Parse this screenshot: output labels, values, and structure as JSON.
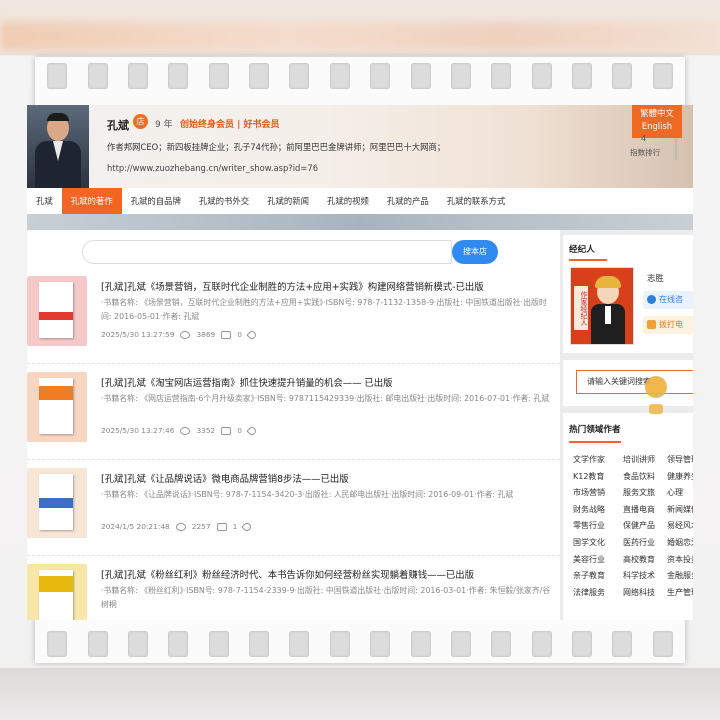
{
  "author": {
    "name": "孔斌",
    "badge": "店",
    "years": "9 年",
    "membership": "创始终身会员 | 好书会员",
    "bio": "作者邦网CEO；新四板挂牌企业；孔子74代孙；前阿里巴巴金牌讲师；阿里巴巴十大网商；",
    "url": "http://www.zuozhebang.cn/writer_show.asp?id=76"
  },
  "lang": {
    "trad": "繁體中文",
    "en": "English"
  },
  "rank": {
    "number": "4",
    "label": "指数排行"
  },
  "nav": [
    {
      "label": "孔斌",
      "active": false
    },
    {
      "label": "孔斌的著作",
      "active": true
    },
    {
      "label": "孔斌的自品牌",
      "active": false
    },
    {
      "label": "孔斌的书外交",
      "active": false
    },
    {
      "label": "孔斌的新闻",
      "active": false
    },
    {
      "label": "孔斌的视频",
      "active": false
    },
    {
      "label": "孔斌的产品",
      "active": false
    },
    {
      "label": "孔斌的联系方式",
      "active": false
    }
  ],
  "search": {
    "placeholder": "",
    "button": "搜本店"
  },
  "books": [
    {
      "title": "[孔斌]孔斌《场景营销，互联时代企业制胜的方法+应用+实践》构建网络营销新模式-已出版",
      "meta": "·书籍名称: 《场景营销，互联时代企业制胜的方法+应用+实践》·ISBN号: 978-7-1132-1358-9·出版社: 中国铁道出版社·出版时间: 2016-05-01·作者: 孔斌",
      "date": "2025/5/30 13:27:59",
      "views": "3869",
      "comments": "0",
      "cover_bg": "#f6c9c9",
      "cover_stripe": "#e23a2c"
    },
    {
      "title": "[孔斌]孔斌《淘宝网店运营指南》抓住快速提升销量的机会—— 已出版",
      "meta": "·书籍名称: 《网店运营指南-6个月升级卖家》·ISBN号: 9787115429339·出版社: 邮电出版社·出版时间: 2016-07-01·作者: 孔斌",
      "date": "2025/5/30 13:27:46",
      "views": "3352",
      "comments": "0",
      "cover_bg": "#f8d6c2",
      "cover_stripe": "#ef7d22"
    },
    {
      "title": "[孔斌]孔斌《让品牌说话》微电商品牌营销8步法——已出版",
      "meta": "·书籍名称: 《让品牌说话》·ISBN号: 978-7-1154-3420-3·出版社: 人民邮电出版社·出版时间: 2016-09-01·作者: 孔斌",
      "date": "2024/1/5 20:21:48",
      "views": "2257",
      "comments": "1",
      "cover_bg": "#f7e6d5",
      "cover_stripe": "#3a6fc4"
    },
    {
      "title": "[孔斌]孔斌《粉丝红利》粉丝经济时代、本书告诉你如何经营粉丝实现躺着赚钱——已出版",
      "meta": "·书籍名称: 《粉丝红利》·ISBN号: 978-7-1154-2339-9·出版社: 中国铁道出版社·出版时间: 2016-03-01·作者: 朱恒毅/张家齐/谷树桐",
      "date": "",
      "views": "",
      "comments": "",
      "cover_bg": "#f7e7a8",
      "cover_stripe": "#e7b90e"
    }
  ],
  "sidebar": {
    "agent_title": "经纪人",
    "agent_name": "志胜",
    "agent_pic_text": "作家经纪人",
    "chat": "在线咨",
    "call": "拨打电",
    "keyword_placeholder": "请输入关键词搜索",
    "hot_title": "热门领域作者",
    "categories": [
      "文学作家",
      "培训讲师",
      "领导管理",
      "K12教育",
      "食品饮料",
      "健康养生",
      "市场营销",
      "服务文旅",
      "心理",
      "财务战略",
      "直播电商",
      "新闻媒体",
      "零售行业",
      "保健产品",
      "易经风水",
      "国学文化",
      "医药行业",
      "婚姻恋爱",
      "美容行业",
      "高校教育",
      "资本投资",
      "亲子教育",
      "科学技术",
      "金融服务",
      "法律服务",
      "网络科技",
      "生产管理"
    ]
  }
}
